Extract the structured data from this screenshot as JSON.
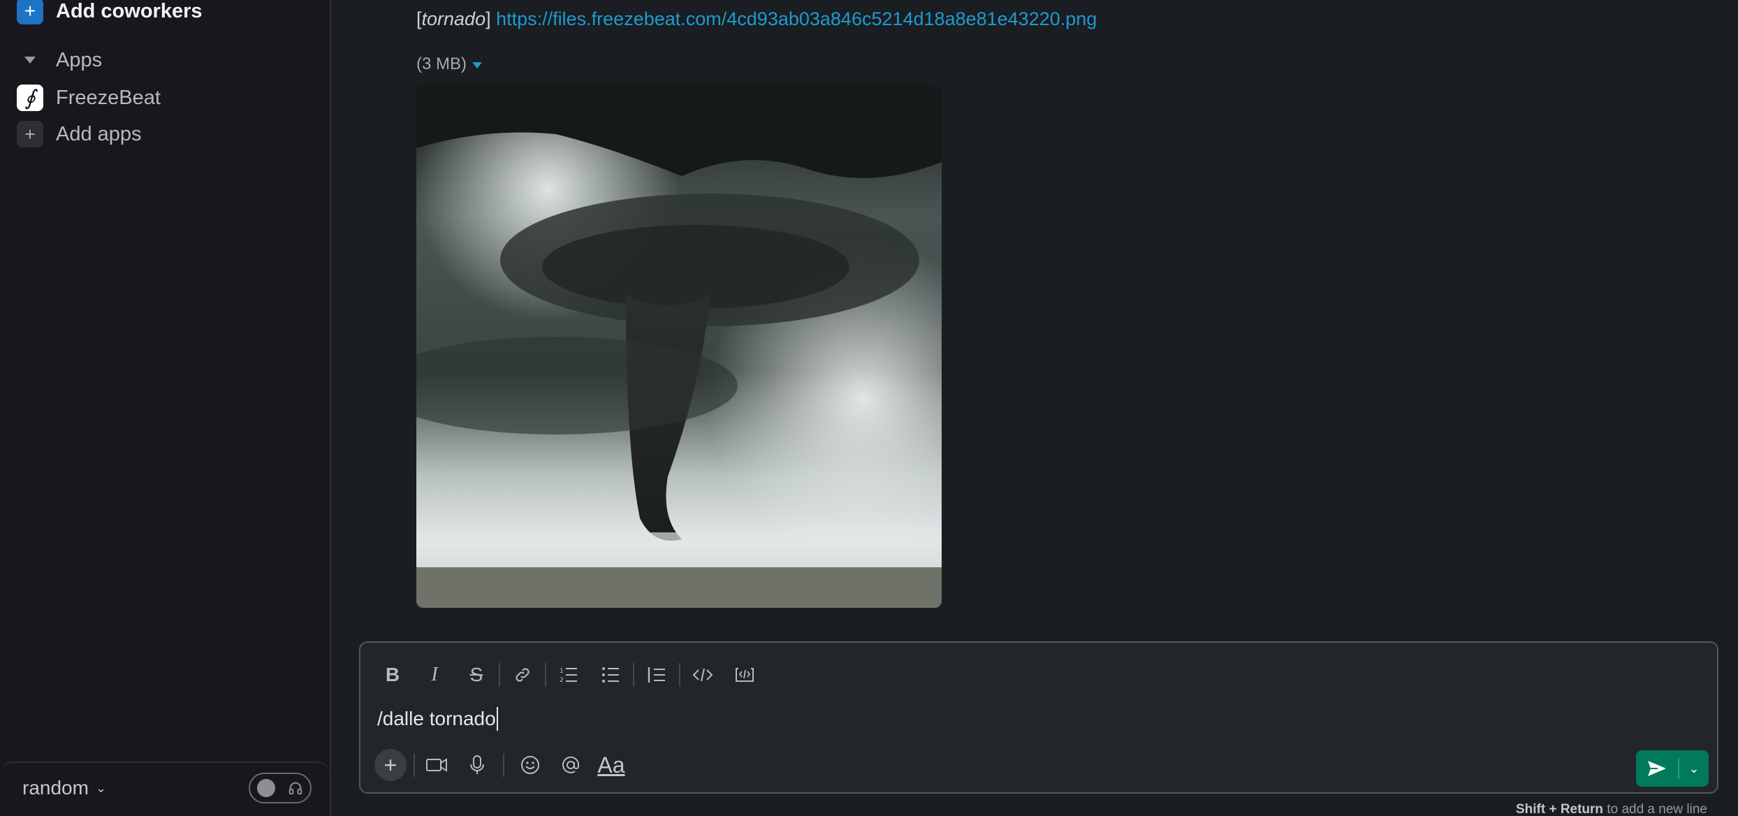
{
  "sidebar": {
    "add_coworkers": "Add coworkers",
    "apps_section": "Apps",
    "apps": [
      {
        "label": "FreezeBeat",
        "icon": "freezebeat-app-icon"
      }
    ],
    "add_apps": "Add apps",
    "footer": {
      "channel": "random"
    }
  },
  "message": {
    "prefix_open": "[",
    "keyword": "tornado",
    "prefix_close": "] ",
    "link": "https://files.freezebeat.com/4cd93ab03a846c5214d18a8e81e43220.png",
    "file_size": "(3 MB)"
  },
  "composer": {
    "text": "/dalle tornado",
    "formatting": [
      "bold",
      "italic",
      "strikethrough",
      "link",
      "ordered-list",
      "bulleted-list",
      "blockquote",
      "code",
      "code-block"
    ],
    "aa_label": "Aa",
    "hint_bold": "Shift + Return",
    "hint_rest": " to add a new line"
  },
  "colors": {
    "accent_blue": "#1d73c6",
    "link": "#1d9bd1",
    "send_green": "#007a5a",
    "background": "#1a1d21"
  }
}
